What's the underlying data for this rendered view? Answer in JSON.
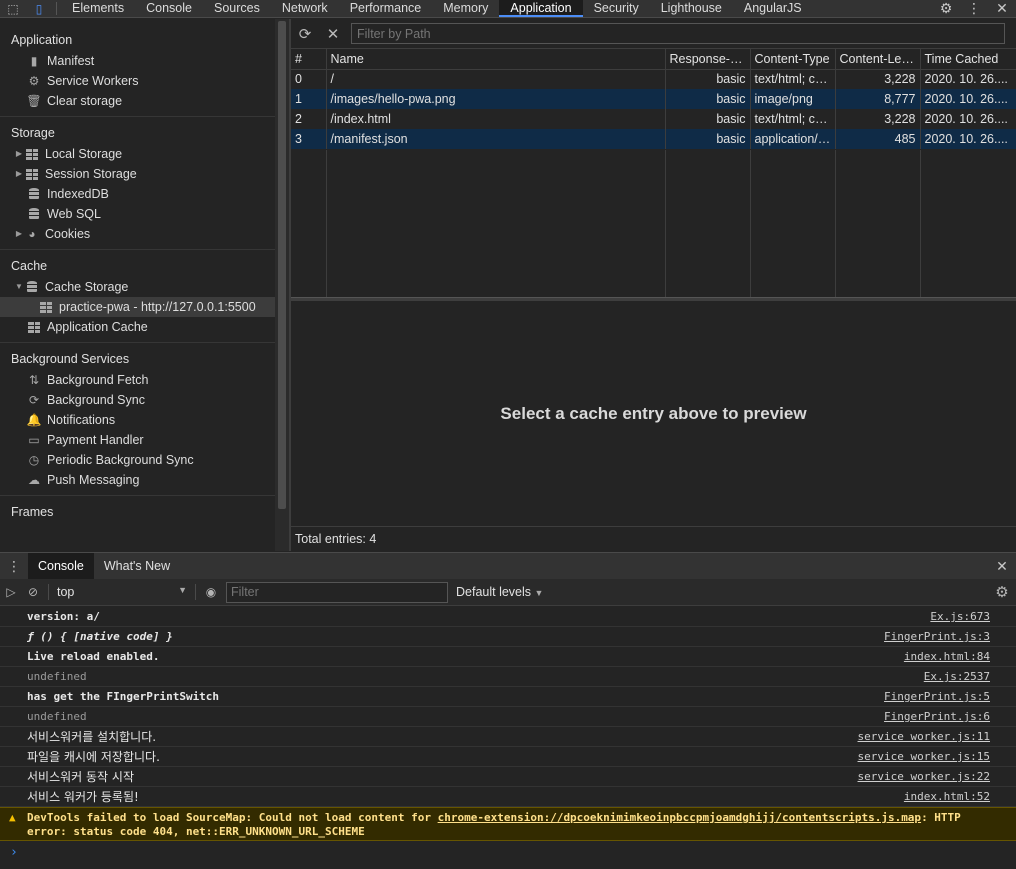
{
  "topbar": {
    "tabs": [
      "Elements",
      "Console",
      "Sources",
      "Network",
      "Performance",
      "Memory",
      "Application",
      "Security",
      "Lighthouse",
      "AngularJS"
    ],
    "active": "Application"
  },
  "sidebar": {
    "application": {
      "title": "Application",
      "items": [
        "Manifest",
        "Service Workers",
        "Clear storage"
      ]
    },
    "storage": {
      "title": "Storage",
      "items": [
        "Local Storage",
        "Session Storage",
        "IndexedDB",
        "Web SQL",
        "Cookies"
      ]
    },
    "cache": {
      "title": "Cache",
      "items": [
        "Cache Storage",
        "practice-pwa - http://127.0.0.1:5500",
        "Application Cache"
      ]
    },
    "background": {
      "title": "Background Services",
      "items": [
        "Background Fetch",
        "Background Sync",
        "Notifications",
        "Payment Handler",
        "Periodic Background Sync",
        "Push Messaging"
      ]
    },
    "frames": {
      "title": "Frames"
    }
  },
  "cache_panel": {
    "filter_placeholder": "Filter by Path",
    "columns": [
      "#",
      "Name",
      "Response-Ty...",
      "Content-Type",
      "Content-Len...",
      "Time Cached"
    ],
    "rows": [
      [
        "0",
        "/",
        "basic",
        "text/html; ch...",
        "3,228",
        "2020. 10. 26...."
      ],
      [
        "1",
        "/images/hello-pwa.png",
        "basic",
        "image/png",
        "8,777",
        "2020. 10. 26...."
      ],
      [
        "2",
        "/index.html",
        "basic",
        "text/html; ch...",
        "3,228",
        "2020. 10. 26...."
      ],
      [
        "3",
        "/manifest.json",
        "basic",
        "application/j...",
        "485",
        "2020. 10. 26...."
      ]
    ],
    "preview_text": "Select a cache entry above to preview",
    "total": "Total entries: 4"
  },
  "drawer": {
    "tabs": [
      "Console",
      "What's New"
    ],
    "context": "top",
    "filter_placeholder": "Filter",
    "levels": "Default levels"
  },
  "console": {
    "logs": [
      {
        "msg": "version: a/",
        "src": "Ex.js:673"
      },
      {
        "msg": "ƒ () { [native code] }",
        "src": "FingerPrint.js:3"
      },
      {
        "msg": "Live reload enabled.",
        "src": "index.html:84"
      },
      {
        "msg": "undefined",
        "src": "Ex.js:2537"
      },
      {
        "msg": "has get the FIngerPrintSwitch",
        "src": "FingerPrint.js:5"
      },
      {
        "msg": "undefined",
        "src": "FingerPrint.js:6"
      },
      {
        "msg": "서비스워커를 설치합니다.",
        "src": "service worker.js:11"
      },
      {
        "msg": "파일을 캐시에 저장합니다.",
        "src": "service worker.js:15"
      },
      {
        "msg": "서비스워커 동작 시작",
        "src": "service worker.js:22"
      },
      {
        "msg": "서비스 워커가 등록됨!",
        "src": "index.html:52"
      }
    ],
    "warning": {
      "prefix": "DevTools failed to load SourceMap: Could not load content for ",
      "link": "chrome-extension://dpcoeknimimkeoinpbccpmjoamdghijj/contentscripts.js.map",
      "suffix": ": HTTP",
      "line2": "error: status code 404, net::ERR_UNKNOWN_URL_SCHEME"
    },
    "prompt": "›"
  },
  "colors": {
    "selected_row": "#0f2b47",
    "accent": "#4c8df6",
    "warning_bg": "#332b00"
  }
}
